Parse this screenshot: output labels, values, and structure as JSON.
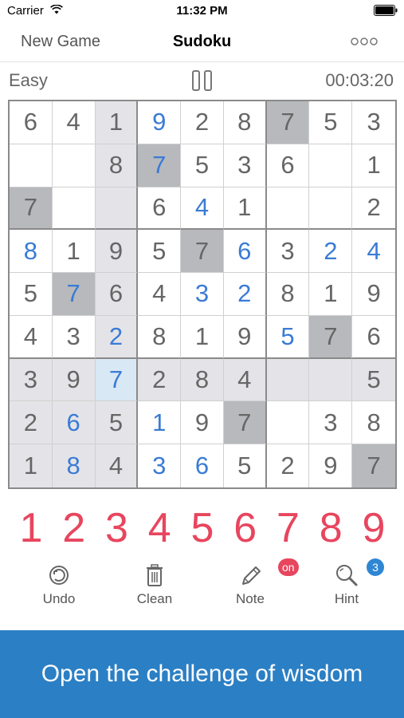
{
  "status_bar": {
    "carrier": "Carrier",
    "time": "11:32 PM"
  },
  "nav": {
    "new_game": "New Game",
    "title": "Sudoku"
  },
  "info": {
    "difficulty": "Easy",
    "timer": "00:03:20"
  },
  "colors": {
    "accent_red": "#e8455e",
    "user_blue": "#3a7bd5",
    "banner_blue": "#2b7fc4"
  },
  "board": {
    "selected_cell": [
      6,
      2
    ],
    "rows": [
      [
        "6",
        "4",
        "1",
        "9",
        "2",
        "8",
        "7",
        "5",
        "3"
      ],
      [
        "",
        "",
        "8",
        "7",
        "5",
        "3",
        "6",
        "",
        "1"
      ],
      [
        "7",
        "",
        "",
        "6",
        "4",
        "1",
        "",
        "",
        "2"
      ],
      [
        "8",
        "1",
        "9",
        "5",
        "7",
        "6",
        "3",
        "2",
        "4"
      ],
      [
        "5",
        "7",
        "6",
        "4",
        "3",
        "2",
        "8",
        "1",
        "9"
      ],
      [
        "4",
        "3",
        "2",
        "8",
        "1",
        "9",
        "5",
        "7",
        "6"
      ],
      [
        "3",
        "9",
        "7",
        "2",
        "8",
        "4",
        "",
        "",
        "5"
      ],
      [
        "2",
        "6",
        "5",
        "1",
        "9",
        "7",
        "",
        "3",
        "8"
      ],
      [
        "1",
        "8",
        "4",
        "3",
        "6",
        "5",
        "2",
        "9",
        "7"
      ]
    ],
    "user_entered": [
      [
        0,
        3
      ],
      [
        1,
        3
      ],
      [
        2,
        4
      ],
      [
        3,
        0
      ],
      [
        3,
        5
      ],
      [
        3,
        7
      ],
      [
        3,
        8
      ],
      [
        4,
        1
      ],
      [
        4,
        4
      ],
      [
        4,
        5
      ],
      [
        5,
        2
      ],
      [
        5,
        6
      ],
      [
        6,
        2
      ],
      [
        7,
        1
      ],
      [
        7,
        3
      ],
      [
        8,
        1
      ],
      [
        8,
        3
      ],
      [
        8,
        4
      ]
    ],
    "same_number_highlight": [
      [
        0,
        6
      ],
      [
        1,
        3
      ],
      [
        2,
        0
      ],
      [
        3,
        4
      ],
      [
        4,
        1
      ],
      [
        5,
        7
      ],
      [
        7,
        5
      ],
      [
        8,
        8
      ]
    ]
  },
  "number_pad": [
    "1",
    "2",
    "3",
    "4",
    "5",
    "6",
    "7",
    "8",
    "9"
  ],
  "toolbar": {
    "undo": "Undo",
    "clean": "Clean",
    "note": "Note",
    "hint": "Hint",
    "note_badge": "on",
    "hint_badge": "3"
  },
  "banner": {
    "text": "Open the challenge of wisdom"
  }
}
